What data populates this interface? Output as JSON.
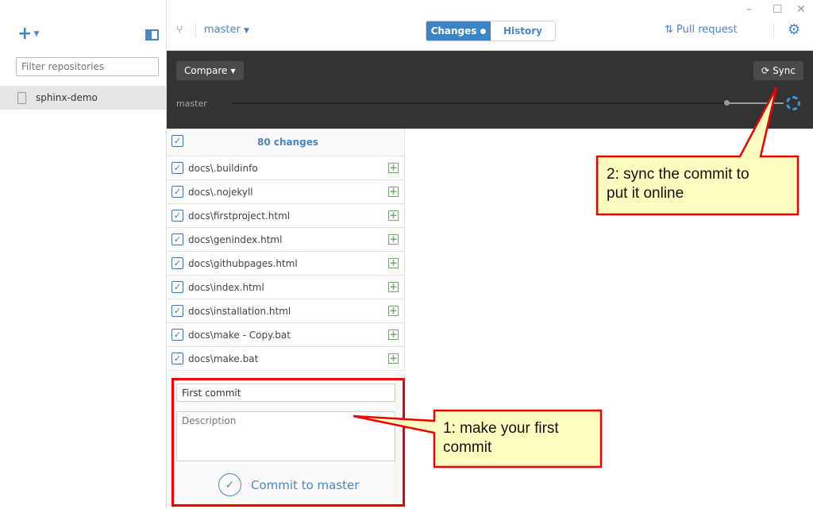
{
  "sidebar": {
    "add_icon": "plus-icon",
    "filter_placeholder": "Filter repositories",
    "repos": [
      {
        "name": "sphinx-demo",
        "icon": "repo-book-icon"
      }
    ]
  },
  "topbar": {
    "branch": "master",
    "tabs": [
      {
        "label": "Changes",
        "active": true
      },
      {
        "label": "History",
        "active": false
      }
    ],
    "pull_request": "Pull request"
  },
  "compare": {
    "compare_label": "Compare",
    "sync_label": "Sync",
    "timeline_branch": "master"
  },
  "changes": {
    "header": "80 changes",
    "files": [
      "docs\\.buildinfo",
      "docs\\.nojekyll",
      "docs\\firstproject.html",
      "docs\\genindex.html",
      "docs\\githubpages.html",
      "docs\\index.html",
      "docs\\installation.html",
      "docs\\make - Copy.bat",
      "docs\\make.bat"
    ]
  },
  "commit": {
    "summary": "First commit",
    "description_placeholder": "Description",
    "button": "Commit to master"
  },
  "annotations": {
    "callout1": [
      "1: make your first",
      "commit"
    ],
    "callout2": [
      "2: sync the commit to",
      "put it online"
    ]
  },
  "colors": {
    "accent": "#3a85c6",
    "dark": "#333333",
    "callout_fill": "#ffffc0",
    "callout_border": "#e00000",
    "added": "#5cb85c"
  }
}
